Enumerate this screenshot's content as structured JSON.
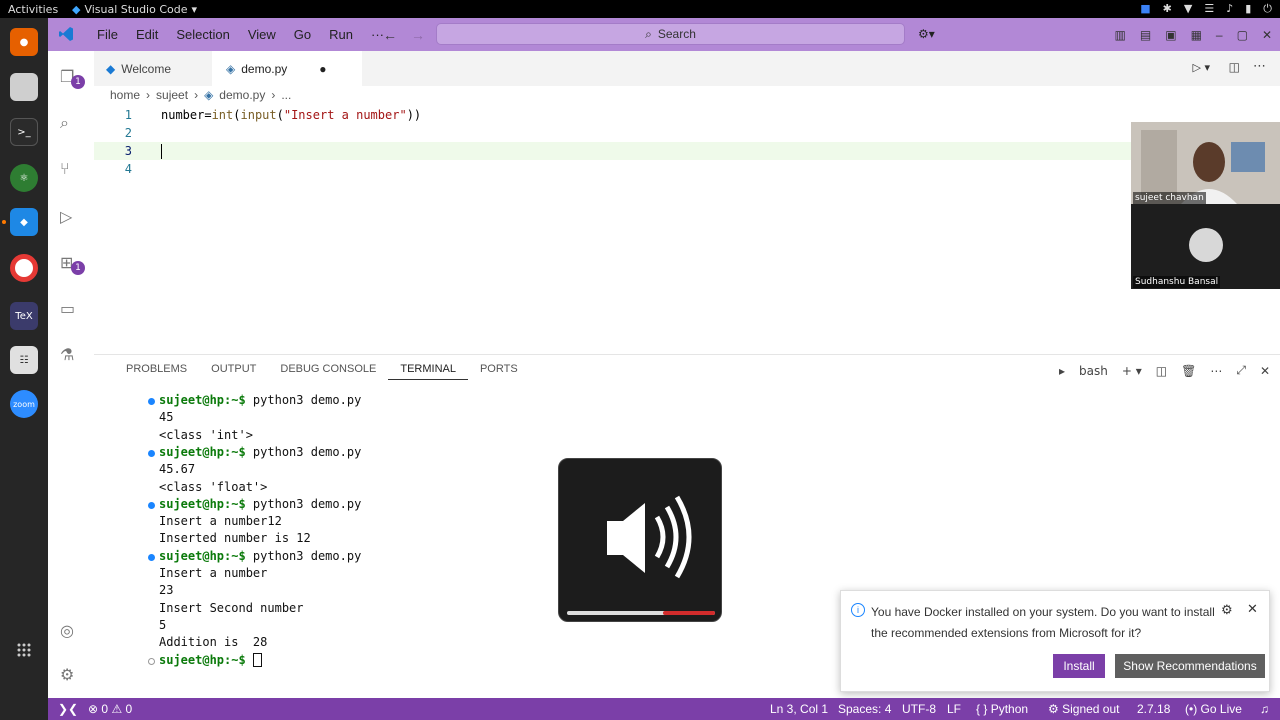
{
  "topbar": {
    "activities": "Activities",
    "app_name": "Visual Studio Code",
    "clock": ""
  },
  "titlebar": {
    "menu": [
      "File",
      "Edit",
      "Selection",
      "View",
      "Go",
      "Run",
      "···"
    ],
    "search": "Search"
  },
  "activity_badges": [
    "1",
    "1"
  ],
  "tabs": [
    {
      "label": "Welcome"
    },
    {
      "label": "demo.py"
    }
  ],
  "breadcrumb": [
    "home",
    "sujeet",
    "demo.py",
    "..."
  ],
  "editor": {
    "lines": [
      {
        "num": "1",
        "parts": [
          {
            "t": "number=",
            "c": ""
          },
          {
            "t": "int",
            "c": "fn"
          },
          {
            "t": "(",
            "c": ""
          },
          {
            "t": "input",
            "c": "fn"
          },
          {
            "t": "(",
            "c": ""
          },
          {
            "t": "\"Insert a number\"",
            "c": "str"
          },
          {
            "t": "))",
            "c": ""
          }
        ]
      },
      {
        "num": "2",
        "parts": []
      },
      {
        "num": "3",
        "parts": []
      },
      {
        "num": "4",
        "parts": []
      }
    ],
    "current_line": 3
  },
  "webcam": {
    "speaker1": "sujeet chavhan",
    "speaker2": "Sudhanshu Bansal"
  },
  "panel": {
    "tabs": [
      "PROBLEMS",
      "OUTPUT",
      "DEBUG CONSOLE",
      "TERMINAL",
      "PORTS"
    ],
    "active_tab": "TERMINAL",
    "shell": "bash"
  },
  "terminal": [
    {
      "prompt": "sujeet@hp:~$",
      "text": " python3 demo.py",
      "dot": "filled"
    },
    {
      "text": "45"
    },
    {
      "text": "<class 'int'>"
    },
    {
      "prompt": "sujeet@hp:~$",
      "text": " python3 demo.py",
      "dot": "filled"
    },
    {
      "text": "45.67"
    },
    {
      "text": "<class 'float'>"
    },
    {
      "prompt": "sujeet@hp:~$",
      "text": " python3 demo.py",
      "dot": "filled"
    },
    {
      "text": "Insert a number12"
    },
    {
      "text": "Inserted number is 12"
    },
    {
      "prompt": "sujeet@hp:~$",
      "text": " python3 demo.py",
      "dot": "filled"
    },
    {
      "text": "Insert a number"
    },
    {
      "text": "23"
    },
    {
      "text": "Insert Second number"
    },
    {
      "text": "5"
    },
    {
      "text": "Addition is  28"
    },
    {
      "prompt": "sujeet@hp:~$",
      "text": " ",
      "dot": "empty",
      "cursor": true
    }
  ],
  "volume": {
    "level": 0.65,
    "overamp": 0.35
  },
  "notification": {
    "message": "You have Docker installed on your system. Do you want to install the recommended extensions from Microsoft for it?",
    "install": "Install",
    "show_recommendations": "Show Recommendations"
  },
  "statusbar": {
    "errors": "0",
    "warnings": "0",
    "position": "Ln 3, Col 1",
    "spaces": "Spaces: 4",
    "encoding": "UTF-8",
    "eol": "LF",
    "language": "Python",
    "account": "Signed out",
    "version": "2.7.18",
    "golive": "Go Live"
  },
  "colors": {
    "accent": "#7b3fa8",
    "titlebar": "#b288d6",
    "terminal_prompt": "#0b7a0b"
  }
}
